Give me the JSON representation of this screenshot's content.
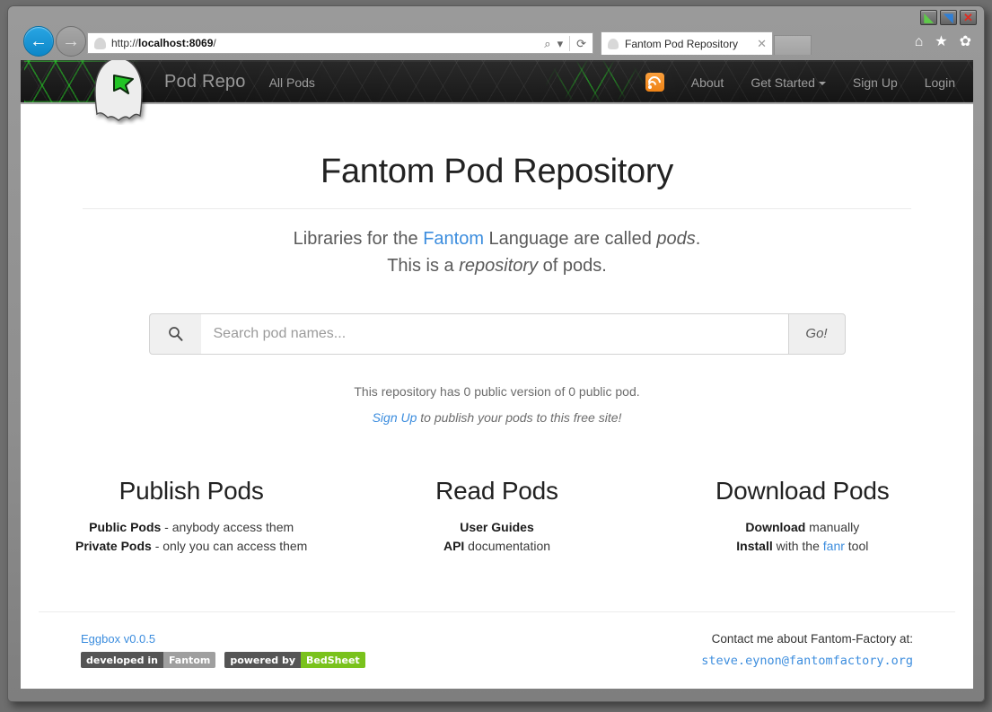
{
  "window": {
    "buttons": [
      {
        "name": "minimize",
        "glyph": "◣"
      },
      {
        "name": "maximize",
        "glyph": "◥"
      },
      {
        "name": "close",
        "glyph": "✕"
      }
    ]
  },
  "browser": {
    "back_glyph": "←",
    "forward_glyph": "→",
    "url_prefix": "http://",
    "url_host": "localhost:8069",
    "url_suffix": "/",
    "search_icon": "⌕",
    "search_caret": "▾",
    "refresh_icon": "⟳",
    "tab": {
      "title": "Fantom Pod Repository",
      "close_glyph": "✕"
    },
    "toolbar_icons": [
      {
        "name": "home-icon",
        "glyph": "⌂"
      },
      {
        "name": "favorites-icon",
        "glyph": "★"
      },
      {
        "name": "settings-icon",
        "glyph": "✿"
      }
    ]
  },
  "navbar": {
    "brand": "Pod Repo",
    "left_links": [
      {
        "name": "all-pods",
        "label": "All Pods"
      }
    ],
    "rss_title": "RSS Feed",
    "right_links": [
      {
        "name": "about",
        "label": "About",
        "caret": false
      },
      {
        "name": "get-started",
        "label": "Get Started",
        "caret": true
      },
      {
        "name": "sign-up",
        "label": "Sign Up",
        "caret": false
      },
      {
        "name": "login",
        "label": "Login",
        "caret": false
      }
    ]
  },
  "main": {
    "title": "Fantom Pod Repository",
    "lead": {
      "line1_a": "Libraries for the ",
      "line1_link": "Fantom",
      "line1_b": " Language are called ",
      "line1_em": "pods",
      "line1_c": ".",
      "line2_a": "This is a ",
      "line2_em": "repository",
      "line2_b": " of pods."
    },
    "search": {
      "placeholder": "Search pod names...",
      "value": "",
      "icon": "⌕",
      "go_label": "Go!"
    },
    "stats": "This repository has 0 public version of 0 public pod.",
    "signup_link": "Sign Up",
    "signup_rest": " to publish your pods to this free site!",
    "features": [
      {
        "name": "publish-pods",
        "heading": "Publish Pods",
        "lines": [
          {
            "bold": "Public Pods",
            "rest": " - anybody access them"
          },
          {
            "bold": "Private Pods",
            "rest": " - only you can access them"
          }
        ]
      },
      {
        "name": "read-pods",
        "heading": "Read Pods",
        "lines": [
          {
            "bold": "User Guides",
            "rest": ""
          },
          {
            "bold": "API",
            "rest": " documentation"
          }
        ]
      },
      {
        "name": "download-pods",
        "heading": "Download Pods",
        "lines": [
          {
            "bold": "Download",
            "rest": " manually"
          },
          {
            "bold": "Install",
            "rest": " with the ",
            "link": "fanr",
            "tail": " tool"
          }
        ]
      }
    ]
  },
  "footer": {
    "version_link": "Eggbox v0.0.5",
    "badges": [
      {
        "name": "developed-in-fantom",
        "key": "developed in",
        "value": "Fantom",
        "value_color": "#9f9f9f"
      },
      {
        "name": "powered-by-bedsheet",
        "key": "powered by",
        "value": "BedSheet",
        "value_color": "#79c21c"
      }
    ],
    "contact_label": "Contact me about Fantom-Factory at:",
    "contact_email": "steve.eynon@fantomfactory.org"
  },
  "colors": {
    "link": "#3c8dde",
    "rss_orange": "#ef8316",
    "badge_green": "#79c21c",
    "navbar_dark": "#1c1c1c",
    "hex_glow_green": "#28dc28"
  }
}
